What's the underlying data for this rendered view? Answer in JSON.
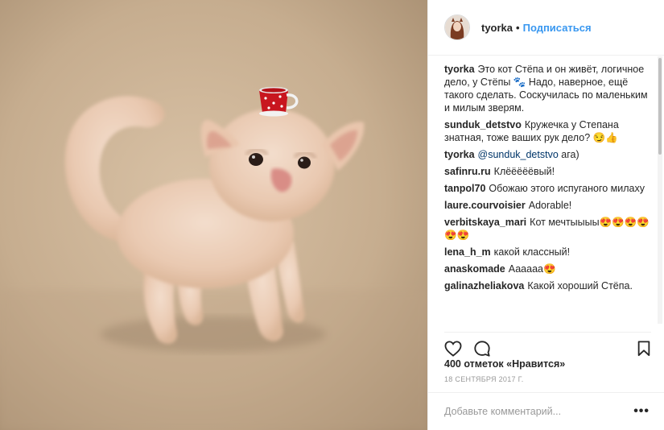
{
  "author": {
    "username": "tyorka",
    "separator": "•",
    "follow_label": "Подписаться"
  },
  "comments": [
    {
      "user": "tyorka",
      "text": "Это кот Стёпа и он живёт, логичное дело, у Стёпы 🐾 Надо, наверное, ещё такого сделать. Соскучилась по маленьким и милым зверям."
    },
    {
      "user": "sunduk_detstvo",
      "text": "Кружечка у Степана знатная, тоже ваших рук дело? 😏👍"
    },
    {
      "user": "tyorka",
      "mention": "@sunduk_detstvo",
      "text": "ага)"
    },
    {
      "user": "safinru.ru",
      "text": "Клёёёёёвый!"
    },
    {
      "user": "tanpol70",
      "text": "Обожаю этого испуганого милаху"
    },
    {
      "user": "laure.courvoisier",
      "text": "Adorable!"
    },
    {
      "user": "verbitskaya_mari",
      "text": "Кот мечтыыыы😍😍😍😍😍😍"
    },
    {
      "user": "lena_h_m",
      "text": "какой классный!"
    },
    {
      "user": "anaskomade",
      "text": "Аааааа😍"
    },
    {
      "user": "galinazheliakova",
      "text": "Какой хороший Стёпа."
    }
  ],
  "icons": {
    "like": "heart-icon",
    "comment": "comment-icon",
    "save": "bookmark-icon",
    "more": "more-icon"
  },
  "likes_text": "400 отметок «Нравится»",
  "date_text": "18 СЕНТЯБРЯ 2017 Г.",
  "add_comment": {
    "placeholder": "Добавьте комментарий...",
    "more_label": "•••"
  },
  "colors": {
    "link": "#3897f0",
    "text": "#262626",
    "muted": "#999999"
  }
}
